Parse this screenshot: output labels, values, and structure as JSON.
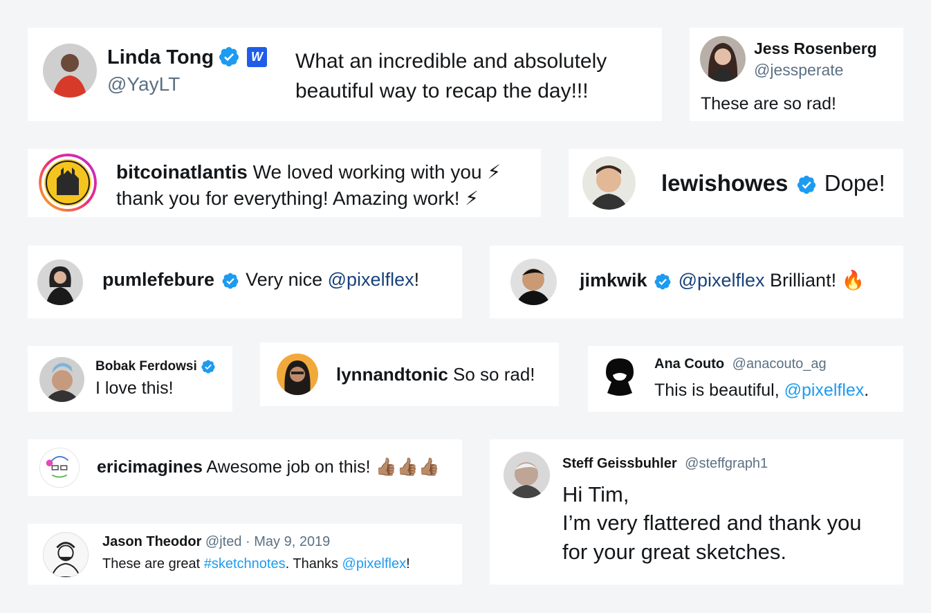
{
  "colors": {
    "background": "#f4f5f7",
    "card": "#ffffff",
    "verified": "#1d9bf0",
    "mention_navy": "#17427a",
    "link_blue": "#1d9bf0",
    "handle_grey": "#5b7083"
  },
  "testimonials": {
    "linda": {
      "name": "Linda Tong",
      "handle": "@YayLT",
      "text_line1": "What an incredible and absolutely",
      "text_line2": "beautiful way to recap the day!!!",
      "verified": true,
      "webflow_badge": "W"
    },
    "jess": {
      "name": "Jess Rosenberg",
      "handle": "@jessperate",
      "text": "These are so rad!"
    },
    "bitcoin": {
      "name": "bitcoinatlantis",
      "text_line1": " We loved working with you ⚡",
      "text_line2": "thank you for everything!  Amazing work! ⚡"
    },
    "lewis": {
      "name": "lewishowes",
      "text": "Dope!",
      "verified": true
    },
    "pumle": {
      "name": "pumlefebure",
      "text_before": "Very nice ",
      "mention": "@pixelflex",
      "text_after": "!",
      "verified": true
    },
    "jim": {
      "name": "jimkwik",
      "mention": "@pixelflex",
      "text_after": " Brilliant! 🔥",
      "verified": true
    },
    "bobak": {
      "name": "Bobak Ferdowsi",
      "text": "I love this!",
      "verified": true
    },
    "lynn": {
      "name": "lynnandtonic",
      "text": " So so rad!"
    },
    "ana": {
      "name": "Ana Couto",
      "handle": "@anacouto_ag",
      "text_before": "This is beautiful, ",
      "mention": "@pixelflex",
      "text_after": "."
    },
    "eric": {
      "name": "ericimagines",
      "text": " Awesome job on this! 👍🏽👍🏽👍🏽"
    },
    "steff": {
      "name": "Steff Geissbuhler",
      "handle": "@steffgraph1",
      "text_line1": "Hi Tim,",
      "text_line2": "I’m very flattered and thank you",
      "text_line3": "for your great sketches."
    },
    "jason": {
      "name": "Jason Theodor",
      "handle_date": " @jted · May 9, 2019",
      "text_before": "These are great ",
      "hashtag": "#sketchnotes",
      "text_mid": ". Thanks ",
      "mention": "@pixelflex",
      "text_after": "!"
    }
  }
}
